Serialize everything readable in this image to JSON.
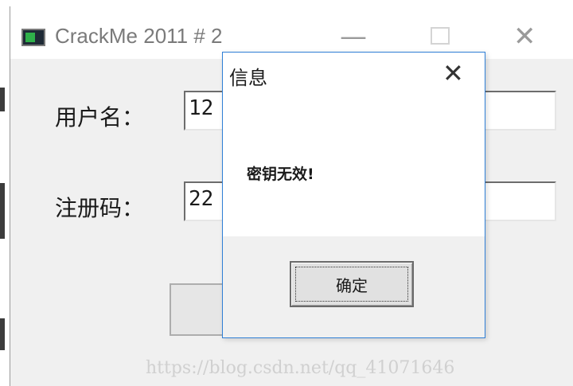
{
  "main_window": {
    "title": "CrackMe 2011 # 2",
    "controls": {
      "minimize": "—",
      "close": "✕"
    },
    "username_label": "用户名：",
    "username_value": "12",
    "regcode_label": "注册码：",
    "regcode_value": "22"
  },
  "dialog": {
    "title": "信息",
    "close": "✕",
    "message": "密钥无效!",
    "ok_label": "确定"
  },
  "watermark": "https://blog.csdn.net/qq_41071646",
  "icons": [
    "app-icon",
    "minimize-icon",
    "maximize-icon",
    "close-icon"
  ],
  "colors": {
    "dialog_border": "#2f7fd6",
    "window_bg": "#f0f0f0"
  }
}
